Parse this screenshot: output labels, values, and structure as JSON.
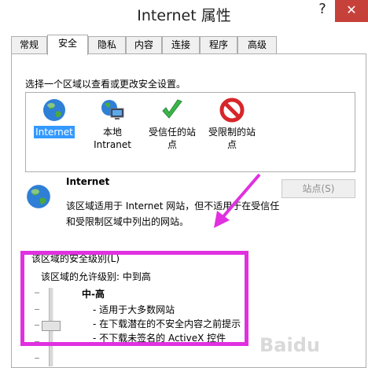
{
  "window": {
    "title": "Internet 属性",
    "help_label": "?",
    "close_label": "✕"
  },
  "tabs": [
    "常规",
    "安全",
    "隐私",
    "内容",
    "连接",
    "程序",
    "高级"
  ],
  "active_tab": "安全",
  "security": {
    "zone_prompt": "选择一个区域以查看或更改安全设置。",
    "zones": [
      {
        "label": "Internet",
        "icon": "globe-icon"
      },
      {
        "label": "本地\nIntranet",
        "icon": "intranet-icon"
      },
      {
        "label": "受信任的站\n点",
        "icon": "trusted-checkmark-icon"
      },
      {
        "label": "受限制的站\n点",
        "icon": "restricted-icon"
      }
    ],
    "selected_zone": "Internet",
    "info_title": "Internet",
    "info_description": "该区域适用于 Internet 网站，但不适用于在受信任和受限制区域中列出的网站。",
    "sites_button": "站点(S)",
    "group_label": "该区域的安全级别(L)",
    "allowed_levels": "该区域的允许级别: 中到高",
    "level_name": "中-高",
    "level_items": [
      "- 适用于大多数网站",
      "- 在下载潜在的不安全内容之前提示",
      "- 不下载未签名的 ActiveX 控件"
    ]
  },
  "colors": {
    "close": "#c7413b",
    "selection": "#3399ff",
    "highlight": "#e030e0"
  },
  "watermark": "Baidu"
}
